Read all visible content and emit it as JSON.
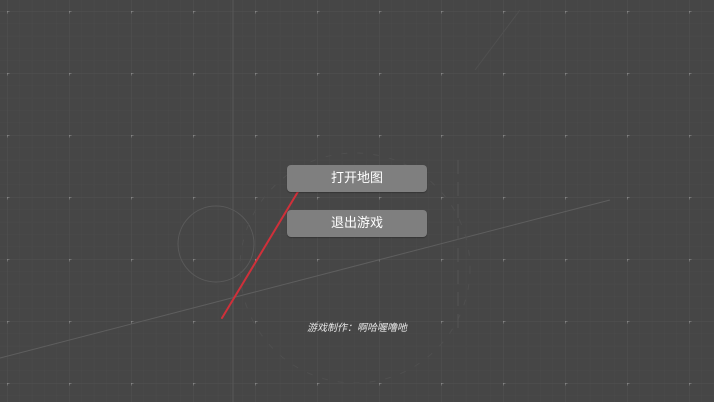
{
  "menu": {
    "open_map_label": "打开地图",
    "quit_game_label": "退出游戏"
  },
  "credit": {
    "text": "游戏制作：啊哈喔噜吔"
  },
  "colors": {
    "background": "#464646",
    "grid_line": "#4d4d4d",
    "grid_dot": "#8a8a8a",
    "button_bg": "#7f7f7f",
    "button_text": "#ffffff",
    "arrow": "#d0303a"
  },
  "icons": {
    "arrow": "red-arrow-icon"
  }
}
